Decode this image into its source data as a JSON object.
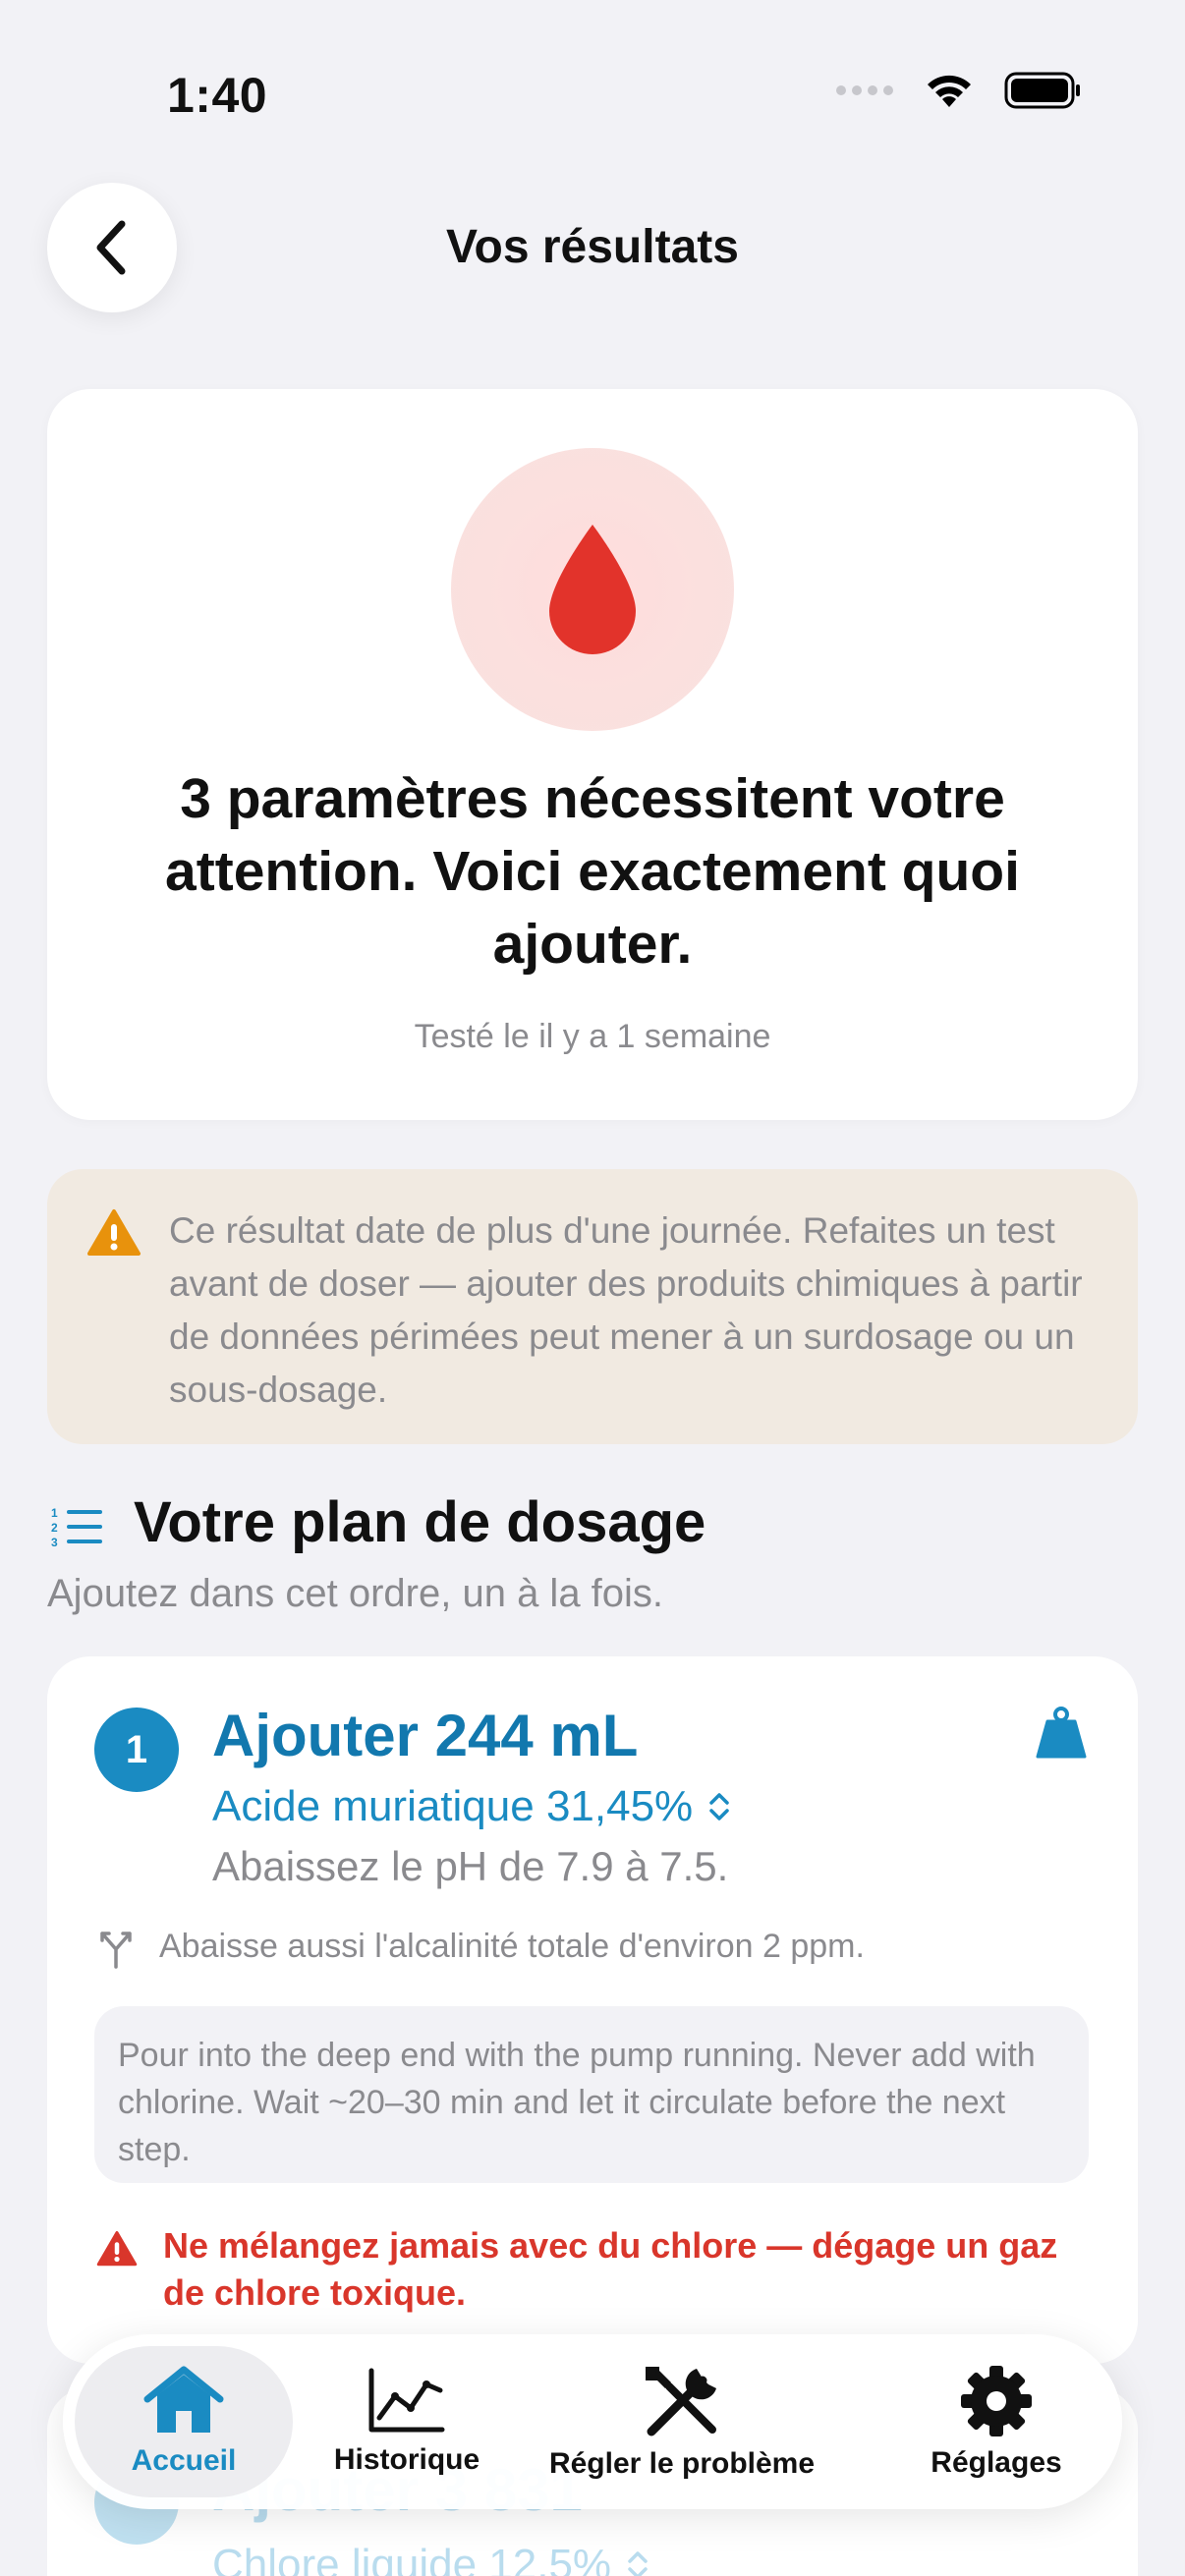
{
  "status_bar": {
    "time": "1:40"
  },
  "header": {
    "title": "Vos résultats",
    "back_icon": "chevron-left-icon"
  },
  "summary": {
    "icon": "drop-icon",
    "headline": "3 paramètres nécessitent votre attention. Voici exactement quoi ajouter.",
    "tested": "Testé le il y a 1 semaine"
  },
  "warning": {
    "icon": "warning-triangle-icon",
    "text": "Ce résultat date de plus d'une journée. Refaites un test avant de doser — ajouter des produits chimiques à partir de données périmées peut mener à un surdosage ou un sous-dosage."
  },
  "plan": {
    "icon": "numbered-list-icon",
    "title": "Votre plan de dosage",
    "subtitle": "Ajoutez dans cet ordre, un à la fois."
  },
  "steps": [
    {
      "number": "1",
      "amount": "Ajouter 244 mL",
      "product": "Acide muriatique 31,45%",
      "effect": "Abaissez le pH de 7.9 à 7.5.",
      "side_effect": "Abaisse aussi l'alcalinité totale d'environ 2 ppm.",
      "instructions": "Pour into the deep end with the pump running. Never add with chlorine. Wait ~20–30 min and let it circulate before the next step.",
      "danger": "Ne mélangez jamais avec du chlore — dégage un gaz de chlore toxique."
    },
    {
      "amount": "Ajouter 3 831",
      "product": "Chlore liquide 12,5%"
    }
  ],
  "tabs": [
    {
      "label": "Accueil",
      "icon": "house-icon",
      "active": true
    },
    {
      "label": "Historique",
      "icon": "chart-line-icon"
    },
    {
      "label": "Régler le problème",
      "icon": "tools-icon"
    },
    {
      "label": "Réglages",
      "icon": "gear-icon"
    }
  ],
  "colors": {
    "accent": "#1A8BC2",
    "danger": "#D9362B",
    "warning": "#E8920C",
    "background": "#F2F2F6"
  }
}
